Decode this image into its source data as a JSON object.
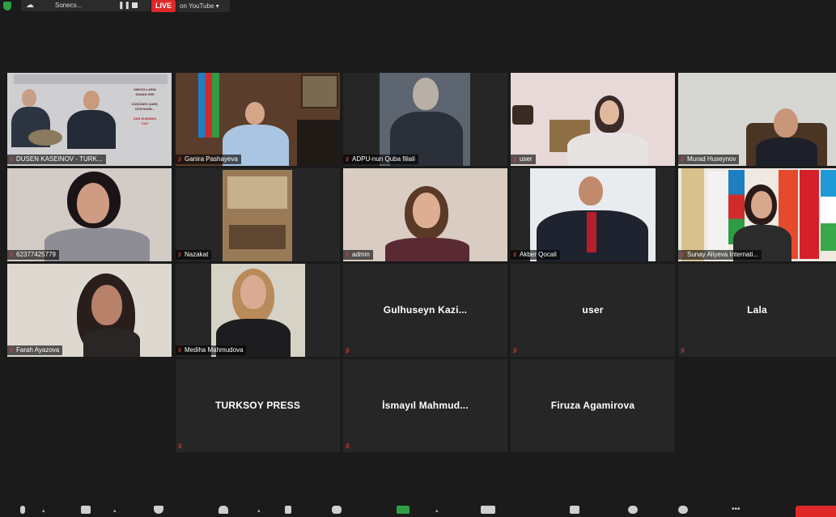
{
  "top_bar": {
    "control_label": "Sonecs...",
    "live_badge": "LIVE",
    "stream_target": "on YouTube"
  },
  "participants": [
    {
      "name": "DUSEN KASEINOV - TURK...",
      "muted": true,
      "active_speaker": true
    },
    {
      "name": "Ganira Pashayeva",
      "muted": true
    },
    {
      "name": "ADPU-nun Quba filiali",
      "muted": true
    },
    {
      "name": "user",
      "muted": true
    },
    {
      "name": "Murad Huseynov",
      "muted": true
    },
    {
      "name": "62377425779",
      "muted": true
    },
    {
      "name": "Nazakat",
      "muted": true
    },
    {
      "name": "admin",
      "muted": true
    },
    {
      "name": "Akber Qocali",
      "muted": true
    },
    {
      "name": "Sunay Aliyeva Internati...",
      "muted": true
    },
    {
      "name": "Farah Ayazova",
      "muted": true
    },
    {
      "name": "Mediha Mahmudova",
      "muted": true
    },
    {
      "name": "Gulhuseyn  Kazi...",
      "muted": true,
      "video_off": true
    },
    {
      "name": "user",
      "muted": true,
      "video_off": true
    },
    {
      "name": "Lala",
      "muted": true,
      "video_off": true
    },
    {
      "name": "TURKSOY PRESS",
      "muted": true,
      "video_off": true
    },
    {
      "name": "İsmayıl  Mahmud...",
      "muted": true,
      "video_off": true
    },
    {
      "name": "Firuza Agamirova",
      "muted": true,
      "video_off": true
    }
  ],
  "slide_text": {
    "line1": "SIMVOLLARIN",
    "line2": "SANAN SIRI",
    "line3": "DÜŞÜNEN ŞAİRİ,",
    "line4": "DÜNYANIN...",
    "line5": "XAN ŞUŞINSKI",
    "line6": "\"120\""
  },
  "toolbar_icons": [
    "mic-icon",
    "video-icon",
    "security-icon",
    "participants-icon",
    "polls-icon",
    "chat-icon",
    "share-screen-icon",
    "record-icon",
    "breakout-icon",
    "reactions-icon",
    "apps-icon",
    "more-icon"
  ],
  "colors": {
    "background": "#1b1b1b",
    "tile": "#262626",
    "active_border": "#c8d84a",
    "muted_red": "#e23b3b",
    "live_red": "#e02828",
    "share_green": "#2ea043"
  }
}
